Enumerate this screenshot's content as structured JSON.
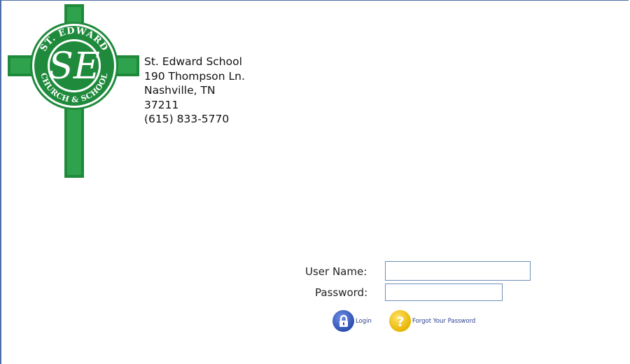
{
  "school": {
    "name": "St. Edward School",
    "street": "190 Thompson Ln.",
    "city_state": "Nashville, TN",
    "zip": "37211",
    "phone": "(615) 833-5770"
  },
  "logo": {
    "monogram": "SE",
    "ring_top": "ST. EDWARD",
    "ring_bottom": "CHURCH & SCHOOL",
    "color": "#1f8a3c"
  },
  "login_form": {
    "username_label": "User Name:",
    "username_value": "",
    "password_label": "Password:",
    "password_value": ""
  },
  "actions": {
    "login_label": "Login",
    "login_icon": "lock-icon",
    "forgot_label": "Forgot Your Password",
    "forgot_icon": "question-icon"
  },
  "colors": {
    "frame_border": "#4d6ea8",
    "login_icon_color": "#2d4fb0",
    "forgot_icon_color": "#e8b400"
  }
}
